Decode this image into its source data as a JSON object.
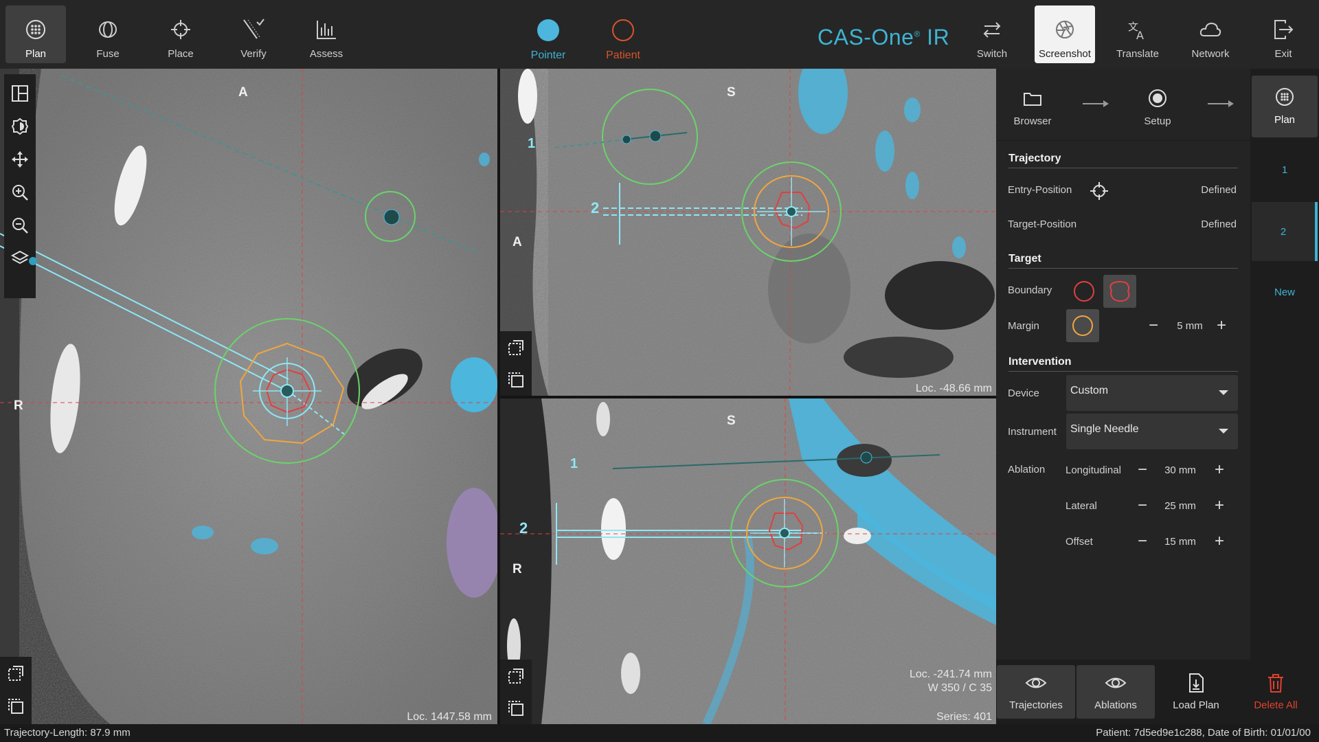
{
  "toolbar": {
    "left": [
      {
        "label": "Plan",
        "icon": "plan-icon"
      },
      {
        "label": "Fuse",
        "icon": "fuse-icon"
      },
      {
        "label": "Place",
        "icon": "place-icon"
      },
      {
        "label": "Verify",
        "icon": "verify-icon"
      },
      {
        "label": "Assess",
        "icon": "assess-icon"
      }
    ],
    "pointer_label": "Pointer",
    "patient_label": "Patient",
    "brand_main": "CAS-One",
    "brand_reg": "®",
    "brand_suffix": " IR",
    "right": [
      {
        "label": "Switch",
        "icon": "switch-icon"
      },
      {
        "label": "Screenshot",
        "icon": "screenshot-icon"
      },
      {
        "label": "Translate",
        "icon": "translate-icon"
      },
      {
        "label": "Network",
        "icon": "network-icon"
      },
      {
        "label": "Exit",
        "icon": "exit-icon"
      }
    ]
  },
  "viewports": {
    "axial": {
      "label_top": "A",
      "label_left": "R",
      "loc": "Loc. 1447.58 mm"
    },
    "sagittal": {
      "label_top": "S",
      "label_left": "A",
      "loc": "Loc. -48.66 mm",
      "traj1": "1",
      "traj2": "2"
    },
    "coronal": {
      "label_top": "S",
      "label_left": "R",
      "loc": "Loc. -241.74 mm",
      "window": "W 350 / C 35",
      "series": "Series: 401",
      "traj1": "1",
      "traj2": "2"
    }
  },
  "workflow": {
    "steps": [
      {
        "label": "Browser",
        "icon": "folder-icon"
      },
      {
        "label": "Setup",
        "icon": "target-icon"
      },
      {
        "label": "Plan",
        "icon": "plan-icon"
      }
    ]
  },
  "panel": {
    "trajectory": {
      "title": "Trajectory",
      "entry_label": "Entry-Position",
      "entry_value": "Defined",
      "target_label": "Target-Position",
      "target_value": "Defined"
    },
    "target": {
      "title": "Target",
      "boundary_label": "Boundary",
      "margin_label": "Margin",
      "margin_value": "5 mm"
    },
    "intervention": {
      "title": "Intervention",
      "device_label": "Device",
      "device_value": "Custom",
      "instrument_label": "Instrument",
      "instrument_value": "Single Needle",
      "ablation_label": "Ablation",
      "longitudinal_label": "Longitudinal",
      "longitudinal_value": "30 mm",
      "lateral_label": "Lateral",
      "lateral_value": "25 mm",
      "offset_label": "Offset",
      "offset_value": "15 mm"
    }
  },
  "trajectory_tabs": [
    "1",
    "2",
    "New"
  ],
  "bottom_buttons": [
    {
      "label": "Trajectories",
      "icon": "eye-icon"
    },
    {
      "label": "Ablations",
      "icon": "eye-icon"
    },
    {
      "label": "Load Plan",
      "icon": "file-download-icon"
    },
    {
      "label": "Delete All",
      "icon": "trash-icon"
    }
  ],
  "status": {
    "left": "Trajectory-Length: 87.9 mm",
    "right": "Patient: 7d5ed9e1c288, Date of Birth: 01/01/00"
  },
  "colors": {
    "accent": "#3fb3d2",
    "patient": "#d9542b",
    "delete": "#e0412f",
    "ablation_zone": "#f0a640",
    "margin_ring": "#6bd36b",
    "boundary": "#e04040",
    "vessel": "#4cb6dd"
  }
}
